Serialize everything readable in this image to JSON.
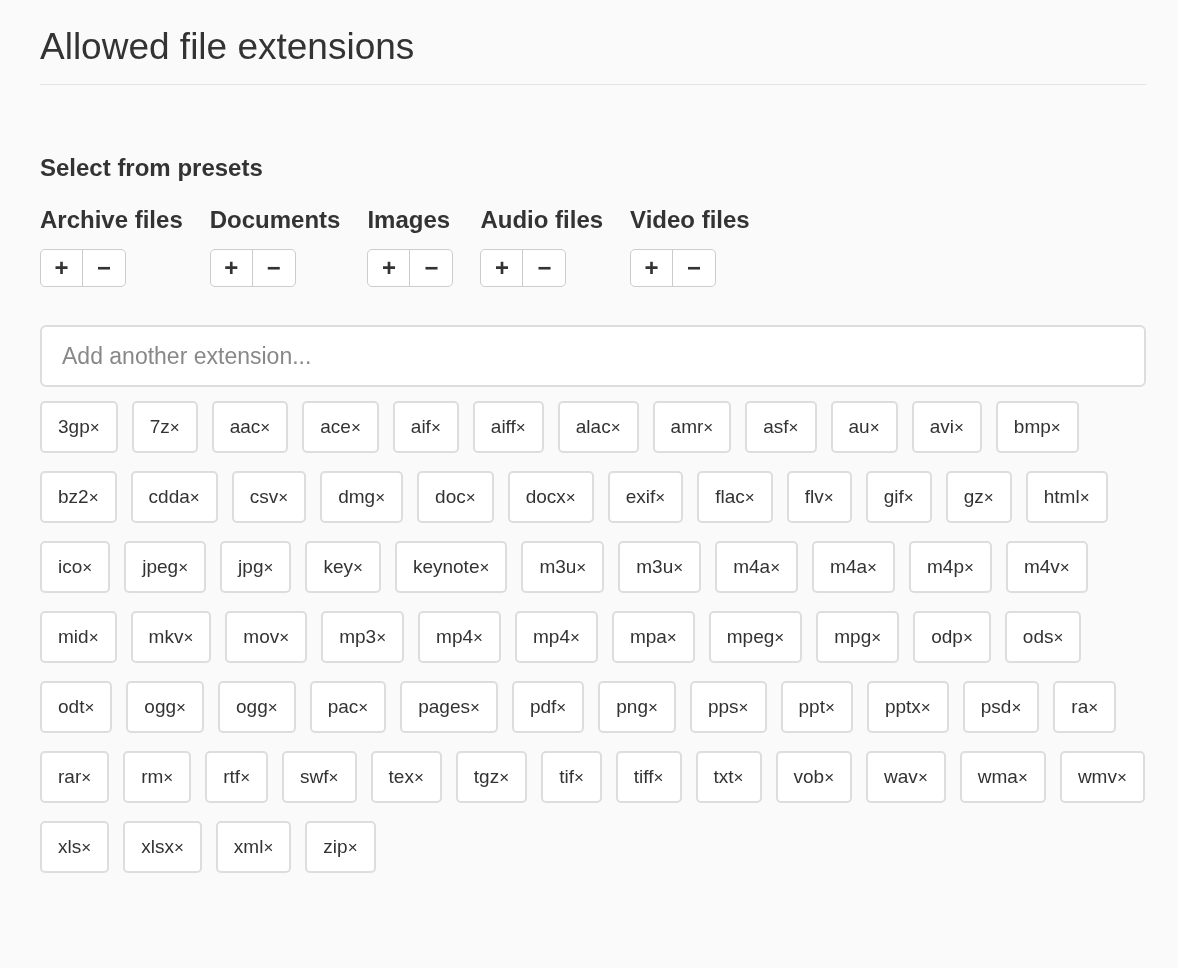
{
  "title": "Allowed file extensions",
  "presets": {
    "heading": "Select from presets",
    "add_glyph": "+",
    "remove_glyph": "−",
    "groups": [
      {
        "label": "Archive files"
      },
      {
        "label": "Documents"
      },
      {
        "label": "Images"
      },
      {
        "label": "Audio files"
      },
      {
        "label": "Video files"
      }
    ]
  },
  "extension_field": {
    "placeholder": "Add another extension..."
  },
  "tag_remove_glyph": "×",
  "tags": [
    "3gp",
    "7z",
    "aac",
    "ace",
    "aif",
    "aiff",
    "alac",
    "amr",
    "asf",
    "au",
    "avi",
    "bmp",
    "bz2",
    "cdda",
    "csv",
    "dmg",
    "doc",
    "docx",
    "exif",
    "flac",
    "flv",
    "gif",
    "gz",
    "html",
    "ico",
    "jpeg",
    "jpg",
    "key",
    "keynote",
    "m3u",
    "m3u",
    "m4a",
    "m4a",
    "m4p",
    "m4v",
    "mid",
    "mkv",
    "mov",
    "mp3",
    "mp4",
    "mp4",
    "mpa",
    "mpeg",
    "mpg",
    "odp",
    "ods",
    "odt",
    "ogg",
    "ogg",
    "pac",
    "pages",
    "pdf",
    "png",
    "pps",
    "ppt",
    "pptx",
    "psd",
    "ra",
    "rar",
    "rm",
    "rtf",
    "swf",
    "tex",
    "tgz",
    "tif",
    "tiff",
    "txt",
    "vob",
    "wav",
    "wma",
    "wmv",
    "xls",
    "xlsx",
    "xml",
    "zip"
  ]
}
